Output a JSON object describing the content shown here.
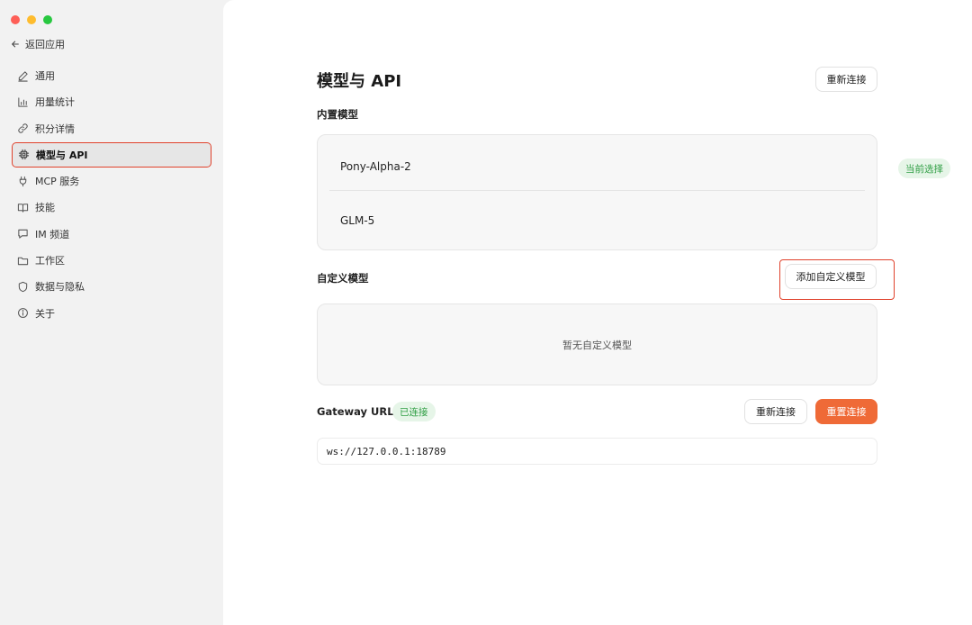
{
  "window": {
    "traffic_lights": {
      "close": "#fe5f57",
      "minimize": "#febc2e",
      "zoom": "#28c840"
    }
  },
  "sidebar": {
    "back": {
      "label": "返回应用",
      "icon": "arrow-left-icon"
    },
    "items": [
      {
        "label": "通用",
        "icon": "pencil-icon",
        "active": false
      },
      {
        "label": "用量统计",
        "icon": "bar-chart-icon",
        "active": false
      },
      {
        "label": "积分详情",
        "icon": "link-icon",
        "active": false
      },
      {
        "label": "模型与 API",
        "icon": "cpu-icon",
        "active": true
      },
      {
        "label": "MCP 服务",
        "icon": "plug-icon",
        "active": false
      },
      {
        "label": "技能",
        "icon": "book-icon",
        "active": false
      },
      {
        "label": "IM 频道",
        "icon": "chat-bubble-icon",
        "active": false
      },
      {
        "label": "工作区",
        "icon": "folder-icon",
        "active": false
      },
      {
        "label": "数据与隐私",
        "icon": "shield-icon",
        "active": false
      },
      {
        "label": "关于",
        "icon": "info-icon",
        "active": false
      }
    ]
  },
  "main": {
    "title": "模型与 API",
    "reconnect_label": "重新连接",
    "builtin": {
      "label": "内置模型",
      "models": [
        "Pony-Alpha-2",
        "GLM-5"
      ],
      "current_badge": "当前选择"
    },
    "custom": {
      "label": "自定义模型",
      "add_label": "添加自定义模型",
      "empty_text": "暂无自定义模型"
    },
    "gateway": {
      "label": "Gateway URL",
      "status": "已连接",
      "reconnect_label": "重新连接",
      "reset_label": "重置连接",
      "url": "ws://127.0.0.1:18789"
    }
  },
  "colors": {
    "accent": "#ef6a37",
    "highlight": "#e0422c",
    "success_text": "#2d9d42",
    "success_bg": "#e6f5e8"
  }
}
